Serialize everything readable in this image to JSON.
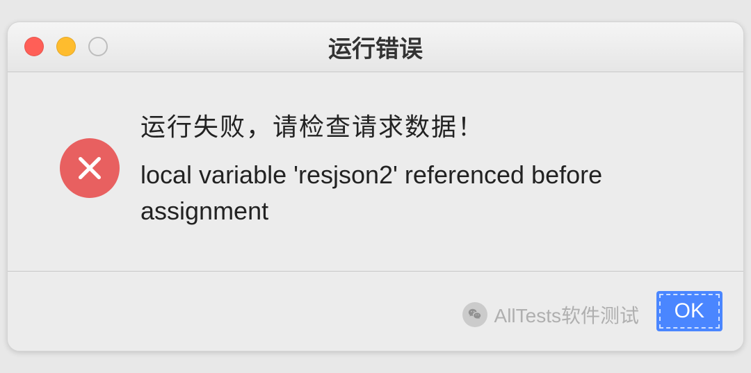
{
  "dialog": {
    "title": "运行错误",
    "message_primary": "运行失败，请检查请求数据！",
    "message_detail": "local variable 'resjson2' referenced before assignment",
    "ok_label": "OK"
  },
  "watermark": {
    "text": "AllTests软件测试"
  }
}
